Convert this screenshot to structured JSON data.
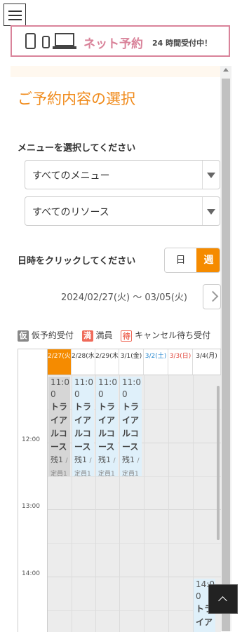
{
  "banner": {
    "title": "ネット予約",
    "subtitle": "24 時間受付中！"
  },
  "page_heading": "ご予約内容の選択",
  "menu_section": {
    "label": "メニューを選択してください",
    "menu_select_value": "すべてのメニュー",
    "resource_select_value": "すべてのリソース"
  },
  "date_section": {
    "label": "日時をクリックしてください",
    "view_day_label": "日",
    "view_week_label": "週",
    "range_text": "2024/02/27(火) 〜 03/05(火)"
  },
  "legend": [
    {
      "badge": "仮",
      "text": "仮予約受付"
    },
    {
      "badge": "満",
      "text": "満員"
    },
    {
      "badge": "待",
      "text": "キャンセル待ち受付"
    }
  ],
  "calendar": {
    "days": [
      {
        "label": "2/27(火)",
        "kind": "today"
      },
      {
        "label": "2/28(水)",
        "kind": "normal"
      },
      {
        "label": "2/29(木)",
        "kind": "normal"
      },
      {
        "label": "3/1(金)",
        "kind": "normal"
      },
      {
        "label": "3/2(土)",
        "kind": "sat"
      },
      {
        "label": "3/3(日)",
        "kind": "sun"
      },
      {
        "label": "3/4(月)",
        "kind": "normal"
      }
    ],
    "times": [
      "12:00",
      "13:00",
      "14:00"
    ],
    "slots": [
      {
        "time": "11:00",
        "name": "トライアルコース",
        "remaining": "残1",
        "capacity": "定員1"
      },
      {
        "time": "11:00",
        "name": "トライアルコース",
        "remaining": "残1",
        "capacity": "定員1"
      },
      {
        "time": "11:00",
        "name": "トライアルコース",
        "remaining": "残1",
        "capacity": "定員1"
      },
      {
        "time": "11:00",
        "name": "トライアルコース",
        "remaining": "残1",
        "capacity": "定員1"
      },
      {
        "time": "14:00",
        "name": "トライア"
      }
    ]
  },
  "colors": {
    "accent": "#f58b00",
    "banner_pink": "#d9839a",
    "slot_blue": "#dff0fa"
  }
}
